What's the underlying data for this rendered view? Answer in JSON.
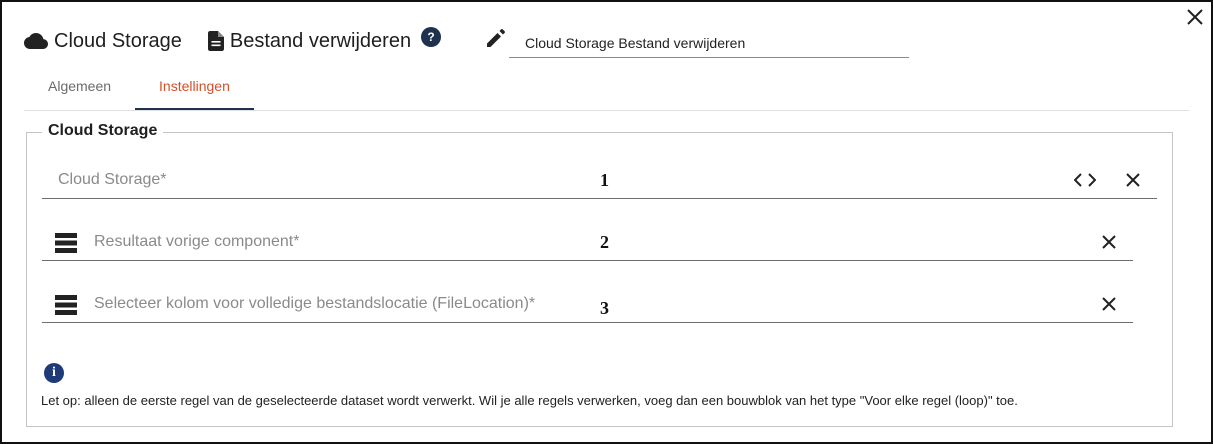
{
  "header": {
    "cloud_title": "Cloud Storage",
    "action_title": "Bestand verwijderen",
    "help_label": "?",
    "name_value": "Cloud Storage Bestand verwijderen"
  },
  "tabs": [
    {
      "label": "Algemeen",
      "active": false
    },
    {
      "label": "Instellingen",
      "active": true
    }
  ],
  "section": {
    "legend": "Cloud Storage",
    "fields": [
      {
        "label": "Cloud Storage*",
        "annotation": "1"
      },
      {
        "label": "Resultaat vorige component*",
        "annotation": "2"
      },
      {
        "label": "Selecteer kolom voor volledige bestandslocatie (FileLocation)*",
        "annotation": "3"
      }
    ]
  },
  "info": {
    "icon_glyph": "i",
    "note": "Let op: alleen de eerste regel van de geselecteerde dataset wordt verwerkt. Wil je alle regels verwerken, voeg dan een bouwblok van het type \"Voor elke regel (loop)\" toe."
  },
  "colors": {
    "accent": "#d4502a",
    "dark_navy": "#1e3250",
    "info_blue": "#1e3a78"
  },
  "icons": [
    "cloud-icon",
    "document-icon",
    "help-icon",
    "pencil-icon",
    "close-icon",
    "code-icon",
    "clear-icon",
    "list-icon",
    "info-icon"
  ]
}
